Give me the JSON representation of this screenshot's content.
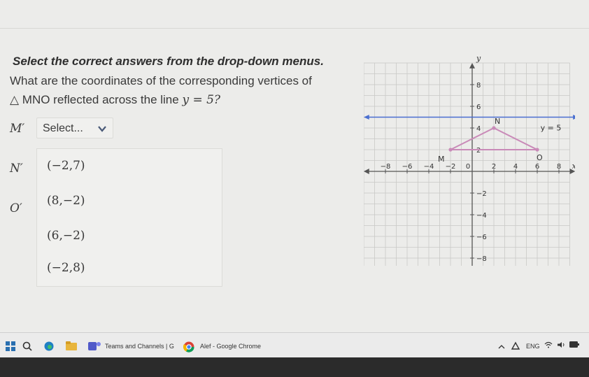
{
  "question": {
    "title": "Select the correct answers from the drop-down menus.",
    "line1": "What are the coordinates of the corresponding vertices of",
    "line2_prefix": "△ MNO reflected across the line",
    "line2_equation": "y = 5?"
  },
  "rows": {
    "m_label": "M′",
    "n_label": "N′",
    "o_label": "O′"
  },
  "select": {
    "value": "Select..."
  },
  "dropdown": {
    "options": [
      "(−2,7)",
      "(8,−2)",
      "(6,−2)",
      "(−2,8)"
    ]
  },
  "graph": {
    "axis_x": "x",
    "axis_y": "y",
    "line_label": "y = 5",
    "vertex_m": "M",
    "vertex_n": "N",
    "vertex_o": "O",
    "x_ticks": [
      "−8",
      "−6",
      "−4",
      "−2",
      "0",
      "2",
      "4",
      "6",
      "8"
    ],
    "y_ticks": [
      "8",
      "6",
      "4",
      "2",
      "−2",
      "−4",
      "−6",
      "−8"
    ],
    "vertices": {
      "M": [
        -2,
        2
      ],
      "N": [
        2,
        4
      ],
      "O": [
        6,
        2
      ]
    },
    "reflection_line_y": 5,
    "triangle_color": "#c98ab8",
    "line_color": "#4a6fd0"
  },
  "taskbar": {
    "app1": "Teams and Channels | G",
    "app2": "Alef - Google Chrome",
    "lang": "ENG"
  }
}
